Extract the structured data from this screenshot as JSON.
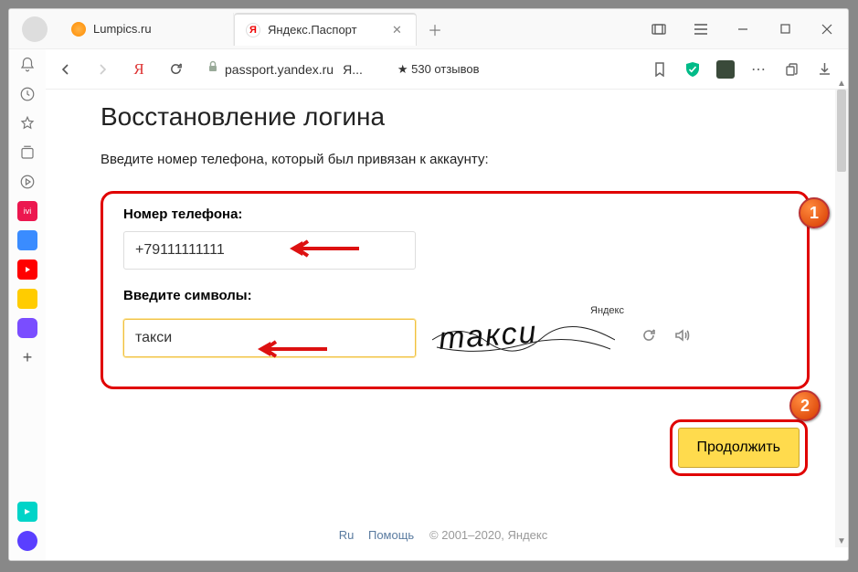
{
  "tabs": {
    "inactive": {
      "label": "Lumpics.ru"
    },
    "active": {
      "label": "Яндекс.Паспорт"
    }
  },
  "address": {
    "host": "passport.yandex.ru",
    "prefix_trunc": "Я..."
  },
  "toolbar": {
    "reviews": "★ 530 отзывов"
  },
  "page": {
    "title": "Восстановление логина",
    "instruction": "Введите номер телефона, который был привязан к аккаунту:",
    "phone_label": "Номер телефона:",
    "phone_value": "+79111111111",
    "captcha_label": "Введите символы:",
    "captcha_value": "такси",
    "captcha_brand": "Яндекс",
    "continue": "Продолжить"
  },
  "footer": {
    "lang": "Ru",
    "help": "Помощь",
    "copyright": "© 2001–2020, Яндекс"
  },
  "markers": {
    "one": "1",
    "two": "2"
  }
}
